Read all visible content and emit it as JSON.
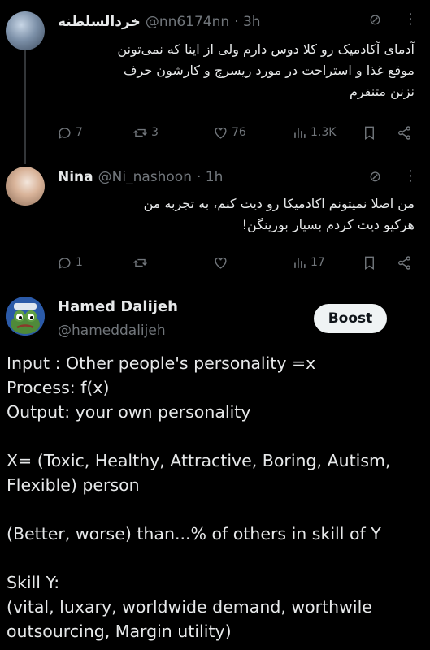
{
  "tweets": [
    {
      "name": "خردالسلطنه",
      "handle": "@nn6174nn",
      "time": "· 3h",
      "lines": [
        "آدمای آکادمیک رو کلا دوس دارم ولی از اینا که نمی‌تونن",
        "موقع غذا و استراحت در مورد ریسرچ و کارشون حرف",
        "نزنن متنفرم"
      ],
      "replies": "7",
      "reposts": "3",
      "likes": "76",
      "views": "1.3K"
    },
    {
      "name": "Nina",
      "handle": "@Ni_nashoon",
      "time": "· 1h",
      "lines": [
        "من اصلا نمیتونم اکادمیکا رو دیت کنم، به تجربه من",
        "هرکیو دیت کردم بسیار بورینگن!"
      ],
      "replies": "1",
      "reposts": "",
      "likes": "",
      "views": "17"
    }
  ],
  "post": {
    "name": "Hamed Dalijeh",
    "handle": "@hameddalijeh",
    "boost_label": "Boost",
    "body": "Input : Other people's personality =x\nProcess: f(x)\nOutput: your own personality\n\nX= (Toxic, Healthy, Attractive, Boring, Autism,\nFlexible) person\n\n(Better, worse) than...% of others in skill of Y\n\nSkill Y:\n(vital, luxary, worldwide demand, worthwile\noutsourcing, Margin utility)"
  },
  "icons": [
    "mute-icon",
    "more-icon",
    "reply-icon",
    "repost-icon",
    "like-icon",
    "views-icon",
    "bookmark-icon",
    "share-icon"
  ]
}
